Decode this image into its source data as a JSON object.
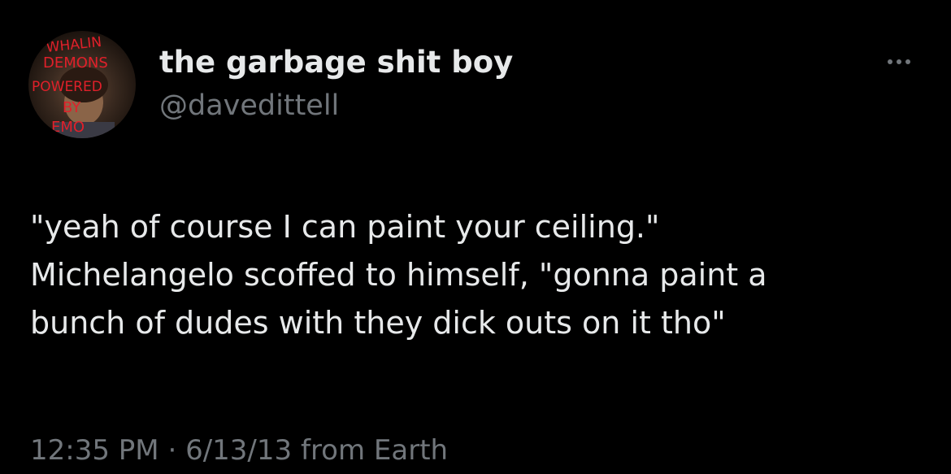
{
  "author": {
    "display_name": "the garbage shit boy",
    "handle": "@davedittell",
    "avatar_scrawl": [
      "WHALIN",
      "DEMONS",
      "POWERED",
      "BY",
      "EMO"
    ]
  },
  "tweet": {
    "lines": [
      "\"yeah of course I can paint your ceiling.\"",
      "Michelangelo scoffed to himself, \"gonna paint a",
      "bunch of dudes with they dick outs on it tho\""
    ]
  },
  "meta": {
    "time": "12:35 PM",
    "separator": "·",
    "date": "6/13/13",
    "source": "from Earth"
  },
  "colors": {
    "background": "#000000",
    "primary_text": "#e7e9ea",
    "secondary_text": "#71767b",
    "scrawl_red": "#e0202a"
  },
  "icons": {
    "more": "more-horizontal-icon"
  }
}
